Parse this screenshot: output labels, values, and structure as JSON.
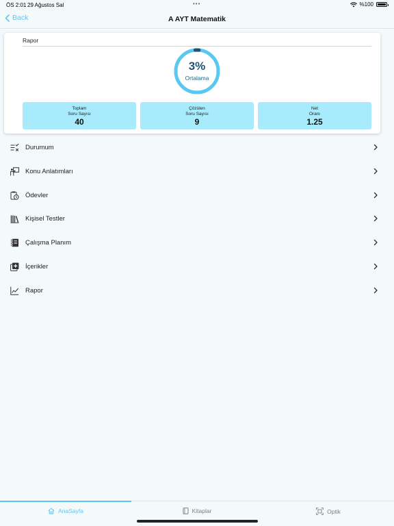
{
  "status_bar": {
    "time": "ÖS 2:01",
    "date": "29 Ağustos Sal",
    "battery": "%100"
  },
  "nav": {
    "back_label": "Back",
    "title": "A AYT Matematik"
  },
  "report": {
    "title": "Rapor",
    "average_percent": "3%",
    "average_label": "Ortalama",
    "average_value": 0.03,
    "accent_color": "#5ac8f0",
    "stats": [
      {
        "line1": "Toplam",
        "line2": "Soru Sayısı",
        "value": "40"
      },
      {
        "line1": "Çözülen",
        "line2": "Soru Sayısı",
        "value": "9"
      },
      {
        "line1": "Net",
        "line2": "Oranı",
        "value": "1.25"
      }
    ]
  },
  "menu": [
    {
      "label": "Durumum",
      "icon": "checklist-icon"
    },
    {
      "label": "Konu Anlatımları",
      "icon": "presentation-icon"
    },
    {
      "label": "Ödevler",
      "icon": "homework-clock-icon"
    },
    {
      "label": "Kişisel Testler",
      "icon": "books-icon"
    },
    {
      "label": "Çalışma Planım",
      "icon": "notebook-icon"
    },
    {
      "label": "İçerikler",
      "icon": "add-content-icon"
    },
    {
      "label": "Rapor",
      "icon": "line-chart-icon"
    }
  ],
  "tabs": [
    {
      "label": "AnaSayfa",
      "icon": "home-icon",
      "active": true
    },
    {
      "label": "Kitaplar",
      "icon": "book-icon",
      "active": false
    },
    {
      "label": "Optik",
      "icon": "scan-icon",
      "active": false
    }
  ]
}
